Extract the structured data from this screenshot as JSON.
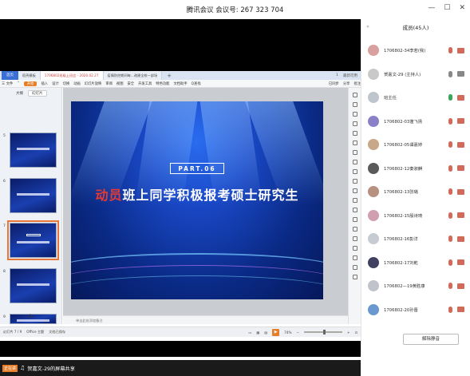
{
  "titlebar": {
    "title": "腾讯会议 会议号: 267 323 704",
    "min": "—",
    "restore": "☐",
    "close": "✕"
  },
  "wps": {
    "home_tab": "首页",
    "tabs": [
      {
        "label": "稻壳模板",
        "active": false
      },
      {
        "label": "1706802班级上班会 - 2020.02.27",
        "active": true
      },
      {
        "label": "疫情防控期间每...改建全校一部场",
        "active": false
      }
    ],
    "menu": [
      "三 文件",
      "⌃",
      "开始",
      "插入",
      "设计",
      "切换",
      "动画",
      "幻灯片放映",
      "审阅",
      "视图",
      "安全",
      "开发工具",
      "特色功能",
      "文档助手",
      "Q查找"
    ],
    "menu_right": [
      "已同步",
      "分享",
      "批注"
    ],
    "tab_right": [
      "1",
      "最新可用"
    ],
    "panel_tabs": [
      "大纲",
      "幻灯片"
    ],
    "slide_numbers": [
      "5",
      "6",
      "7",
      "8",
      "9"
    ],
    "add_slide": "+",
    "notes_placeholder": "单击此处添加备注",
    "status_left": [
      "幻灯片 7 / 9",
      "Office 主题",
      "文档已保存"
    ],
    "zoom": "74%"
  },
  "slide": {
    "part": "PART.06",
    "title_red": "动员",
    "title_white": "班上同学积极报考硕士研究生"
  },
  "share_footer": {
    "onair": "正在讲",
    "text": "贺嘉文-29的屏幕共享"
  },
  "members": {
    "heading": "成员(45人)",
    "collapse": "«",
    "list": [
      {
        "name": "1706802-34李若(我)",
        "avatar_color": "#d9a0a0",
        "mic": "#d26a5a",
        "cam": "#d26a5a"
      },
      {
        "name": "贺嘉文-29 (主持人)",
        "avatar_color": "#c9c9c9",
        "mic": "#888888",
        "cam": "#888888"
      },
      {
        "name": "班主任",
        "avatar_color": "#bfc5cc",
        "mic": "#3aa55a",
        "cam": "#d26a5a"
      },
      {
        "name": "1706802-03蓬飞扬",
        "avatar_color": "#8a80c8",
        "mic": "#d26a5a",
        "cam": "#d26a5a"
      },
      {
        "name": "1706802-05谭嘉婷",
        "avatar_color": "#c8a888",
        "mic": "#d26a5a",
        "cam": "#d26a5a"
      },
      {
        "name": "1706802-12秦淑麒",
        "avatar_color": "#5a5a5a",
        "mic": "#d26a5a",
        "cam": "#d26a5a"
      },
      {
        "name": "1706802-13张璐",
        "avatar_color": "#b89080",
        "mic": "#d26a5a",
        "cam": "#d26a5a"
      },
      {
        "name": "1706802-15殷诗琦",
        "avatar_color": "#d0a0b0",
        "mic": "#d26a5a",
        "cam": "#d26a5a"
      },
      {
        "name": "1706802-16彭洋",
        "avatar_color": "#c7ccd2",
        "mic": "#d26a5a",
        "cam": "#d26a5a"
      },
      {
        "name": "1706802-17刘乾",
        "avatar_color": "#404060",
        "mic": "#d26a5a",
        "cam": "#d26a5a"
      },
      {
        "name": "1706802—19黄胜康",
        "avatar_color": "#c0c4ca",
        "mic": "#d26a5a",
        "cam": "#d26a5a"
      },
      {
        "name": "1706802-20孙晋",
        "avatar_color": "#6a98d0",
        "mic": "#d26a5a",
        "cam": "#d26a5a"
      }
    ],
    "unmute_button": "解除静音"
  }
}
